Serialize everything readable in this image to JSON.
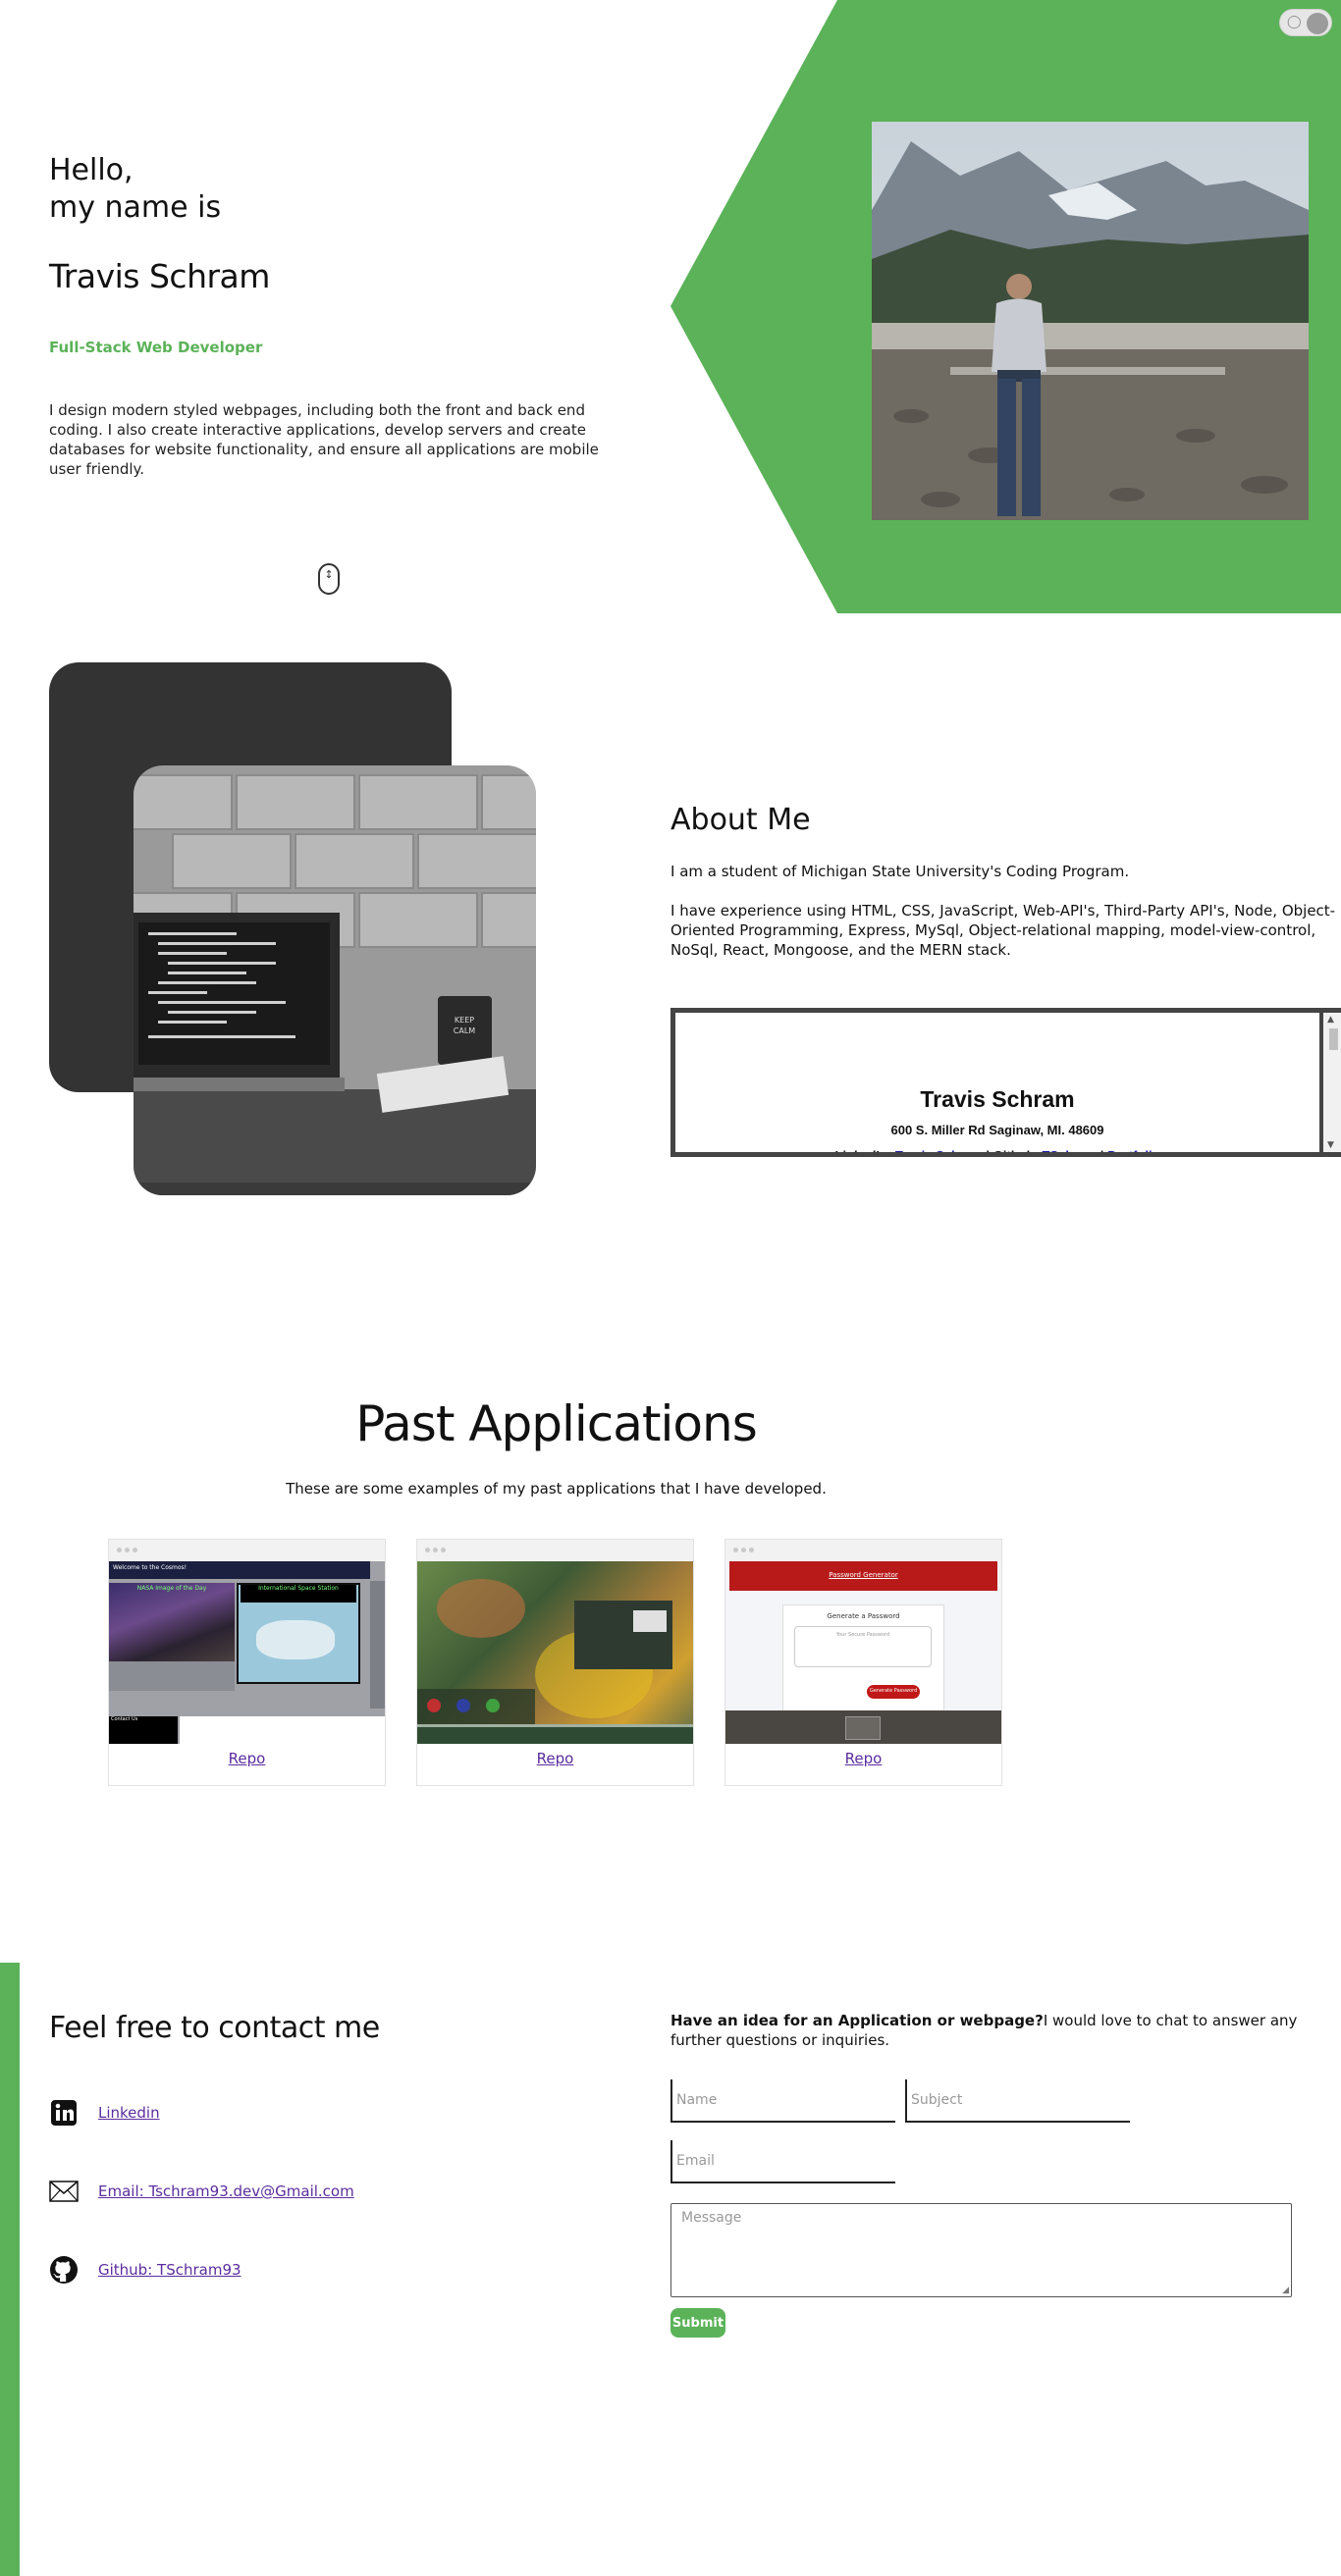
{
  "colors": {
    "accent": "#5bb258",
    "dark": "#333333",
    "link": "#5b2d9e"
  },
  "theme_toggle": {
    "icon": "lightbulb-icon"
  },
  "hero": {
    "hello_line1": "Hello,",
    "hello_line2": "my name is",
    "name": "Travis Schram",
    "role": "Full-Stack Web Developer",
    "description": "I design modern styled webpages, including both the front and back end coding. I also create interactive applications, develop servers and create databases for website functionality, and ensure all applications are mobile user friendly.",
    "scroll_icon": "mouse-scroll-icon"
  },
  "about": {
    "title": "About Me",
    "paragraph1": "I am a student of Michigan State University's Coding Program.",
    "paragraph2": "I have experience using HTML, CSS, JavaScript, Web-API's, Third-Party API's, Node, Object-Oriented Programming, Express, MySql, Object-relational mapping, model-view-control, NoSql, React, Mongoose, and the MERN stack.",
    "resume": {
      "name": "Travis Schram",
      "address": "600 S. Miller Rd Saginaw, MI. 48609",
      "linkedin_label": "LinkedIn:",
      "linkedin_value": "Travis Schram",
      "separator1": "|",
      "github_label": "Github:",
      "github_value": "TSchram",
      "separator2": "|",
      "portfolio_value": "Portfolio"
    }
  },
  "projects": {
    "title": "Past Applications",
    "subtitle": "These are some examples of my past applications that I have developed.",
    "cards": [
      {
        "repo_label": "Repo",
        "nav_title": "Welcome to the Cosmos!",
        "left_panel": "NASA Image of the Day",
        "right_panel": "International Space Station",
        "footer_left": "Contact Us"
      },
      {
        "repo_label": "Repo"
      },
      {
        "repo_label": "Repo",
        "header": "Password Generator",
        "card_title": "Generate a Password",
        "placeholder": "Your Secure Password",
        "button": "Generate Password"
      }
    ]
  },
  "contact": {
    "title": "Feel free to contact me",
    "links": [
      {
        "icon": "linkedin-icon",
        "label": "Linkedin"
      },
      {
        "icon": "envelope-icon",
        "label": "Email: Tschram93.dev@Gmail.com"
      },
      {
        "icon": "github-icon",
        "label": "Github: TSchram93"
      }
    ],
    "intro_bold": "Have an idea for an Application or webpage?",
    "intro_rest": "I would love to chat to answer any further questions or inquiries.",
    "form": {
      "name_placeholder": "Name",
      "subject_placeholder": "Subject",
      "email_placeholder": "Email",
      "message_placeholder": "Message",
      "submit_label": "Submit"
    }
  }
}
